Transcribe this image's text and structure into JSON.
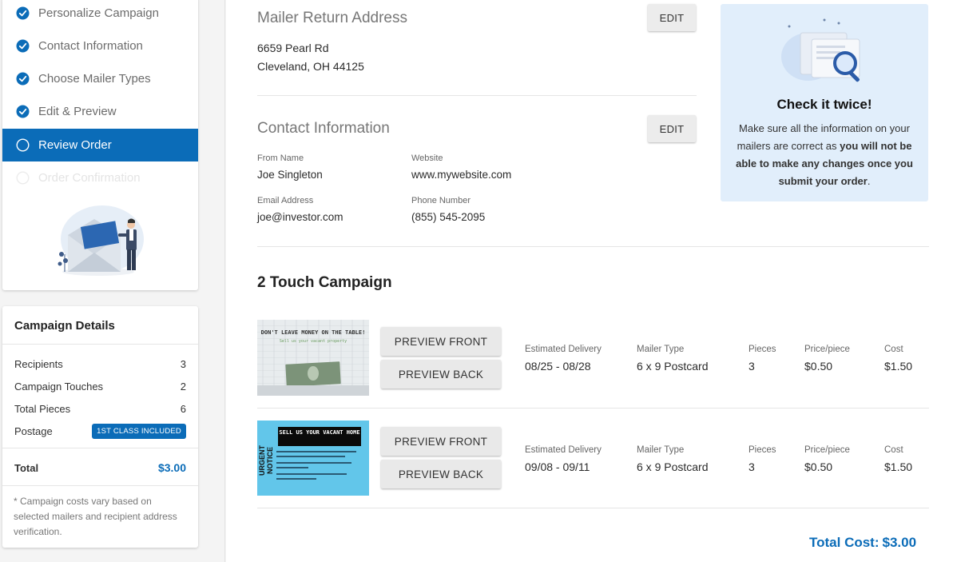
{
  "steps": [
    {
      "label": "Personalize Campaign",
      "state": "done"
    },
    {
      "label": "Contact Information",
      "state": "done"
    },
    {
      "label": "Choose Mailer Types",
      "state": "done"
    },
    {
      "label": "Edit & Preview",
      "state": "done"
    },
    {
      "label": "Review Order",
      "state": "active"
    },
    {
      "label": "Order Confirmation",
      "state": "pending"
    }
  ],
  "campaign_details": {
    "title": "Campaign Details",
    "rows": [
      {
        "label": "Recipients",
        "value": "3"
      },
      {
        "label": "Campaign Touches",
        "value": "2"
      },
      {
        "label": "Total Pieces",
        "value": "6"
      }
    ],
    "postage_label": "Postage",
    "postage_badge": "1ST CLASS INCLUDED",
    "total_label": "Total",
    "total_value": "$3.00",
    "note": "* Campaign costs vary based on selected mailers and recipient address verification."
  },
  "return_address": {
    "heading": "Mailer Return Address",
    "edit_label": "EDIT",
    "line1": "6659 Pearl Rd",
    "line2": "Cleveland, OH 44125"
  },
  "contact": {
    "heading": "Contact Information",
    "edit_label": "EDIT",
    "from_name_label": "From Name",
    "from_name": "Joe Singleton",
    "website_label": "Website",
    "website": "www.mywebsite.com",
    "email_label": "Email Address",
    "email": "joe@investor.com",
    "phone_label": "Phone Number",
    "phone": "(855) 545-2095"
  },
  "tip": {
    "title": "Check it twice!",
    "text_plain": "Make sure all the information on your mailers are correct as ",
    "text_bold": "you will not be able to make any changes once you submit your order",
    "text_end": "."
  },
  "campaign": {
    "title": "2 Touch Campaign",
    "column_labels": {
      "delivery": "Estimated Delivery",
      "type": "Mailer Type",
      "pieces": "Pieces",
      "price": "Price/piece",
      "cost": "Cost"
    },
    "preview_front_label": "PREVIEW FRONT",
    "preview_back_label": "PREVIEW BACK",
    "mailers": [
      {
        "thumb_headline": "DON'T LEAVE MONEY ON THE TABLE!",
        "thumb_sub": "Sell us your vacant property",
        "delivery": "08/25 - 08/28",
        "type": "6 x 9 Postcard",
        "pieces": "3",
        "price": "$0.50",
        "cost": "$1.50"
      },
      {
        "thumb_side": "URGENT NOTICE",
        "thumb_headline": "SELL US YOUR VACANT HOME",
        "delivery": "09/08 - 09/11",
        "type": "6 x 9 Postcard",
        "pieces": "3",
        "price": "$0.50",
        "cost": "$1.50"
      }
    ]
  },
  "total_cost": {
    "label": "Total Cost:",
    "value": "$3.00"
  },
  "colors": {
    "accent": "#0b6cb8",
    "tip_bg": "#e1eefb",
    "thumb2_bg": "#62c6ea"
  }
}
